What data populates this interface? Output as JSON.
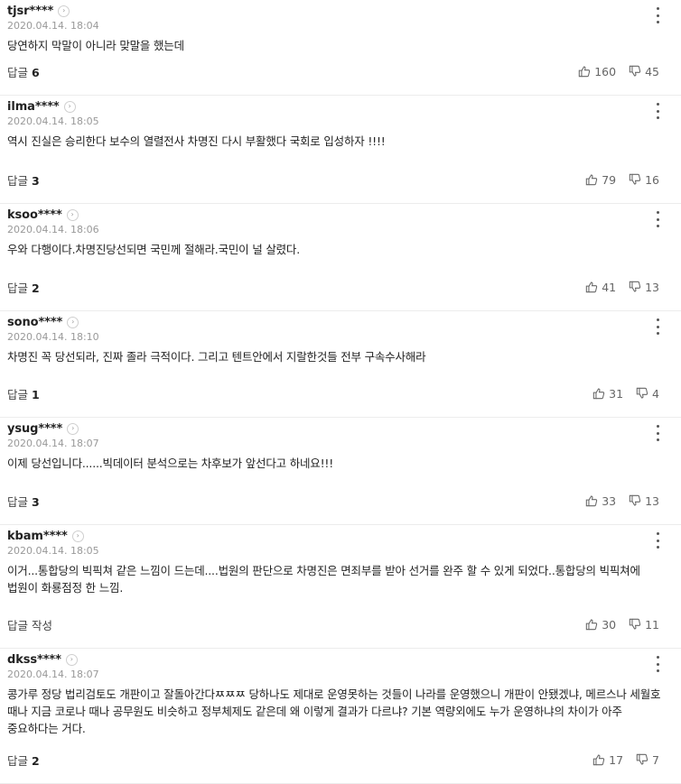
{
  "reply_label": "답글",
  "reply_write_label": "답글 작성",
  "comments": [
    {
      "nick": "tjsr****",
      "date": "2020.04.14. 18:04",
      "text": "당연하지 막말이 아니라 맞말을 했는데",
      "replies": "6",
      "likes": "160",
      "dislikes": "45"
    },
    {
      "nick": "ilma****",
      "date": "2020.04.14. 18:05",
      "text": "역시 진실은 승리한다 보수의 열렬전사 차명진 다시 부활했다 국회로 입성하자 !!!!",
      "replies": "3",
      "likes": "79",
      "dislikes": "16"
    },
    {
      "nick": "ksoo****",
      "date": "2020.04.14. 18:06",
      "text": "우와 다행이다.차명진당선되면 국민께 절해라.국민이 널 살렸다.",
      "replies": "2",
      "likes": "41",
      "dislikes": "13"
    },
    {
      "nick": "sono****",
      "date": "2020.04.14. 18:10",
      "text": "차명진 꼭 당선되라, 진짜 졸라 극적이다. 그리고 텐트안에서 지랄한것들 전부 구속수사해라",
      "replies": "1",
      "likes": "31",
      "dislikes": "4"
    },
    {
      "nick": "ysug****",
      "date": "2020.04.14. 18:07",
      "text": "이제 당선입니다......빅데이터 분석으로는 차후보가 앞선다고 하네요!!!",
      "replies": "3",
      "likes": "33",
      "dislikes": "13"
    },
    {
      "nick": "kbam****",
      "date": "2020.04.14. 18:05",
      "text": "이거...통합당의 빅픽쳐 같은 느낌이 드는데....법원의 판단으로 차명진은 면죄부를 받아 선거를 완주 할 수 있게 되었다..통합당의 빅픽쳐에 법원이 화룡점정 한 느낌.",
      "replies": "",
      "likes": "30",
      "dislikes": "11"
    },
    {
      "nick": "dkss****",
      "date": "2020.04.14. 18:07",
      "text": "콩가루 정당 법리검토도 개판이고 잘돌아간다ㅉㅉㅉ 당하나도 제대로 운영못하는 것들이 나라를 운영했으니 개판이 안됐겠냐, 메르스나 세월호 때나 지금 코로나 때나 공무원도 비슷하고 정부체제도 같은데 왜 이렇게 결과가 다르냐? 기본 역량외에도 누가 운영하냐의 차이가 아주 중요하다는 거다.",
      "replies": "2",
      "likes": "17",
      "dislikes": "7"
    }
  ]
}
